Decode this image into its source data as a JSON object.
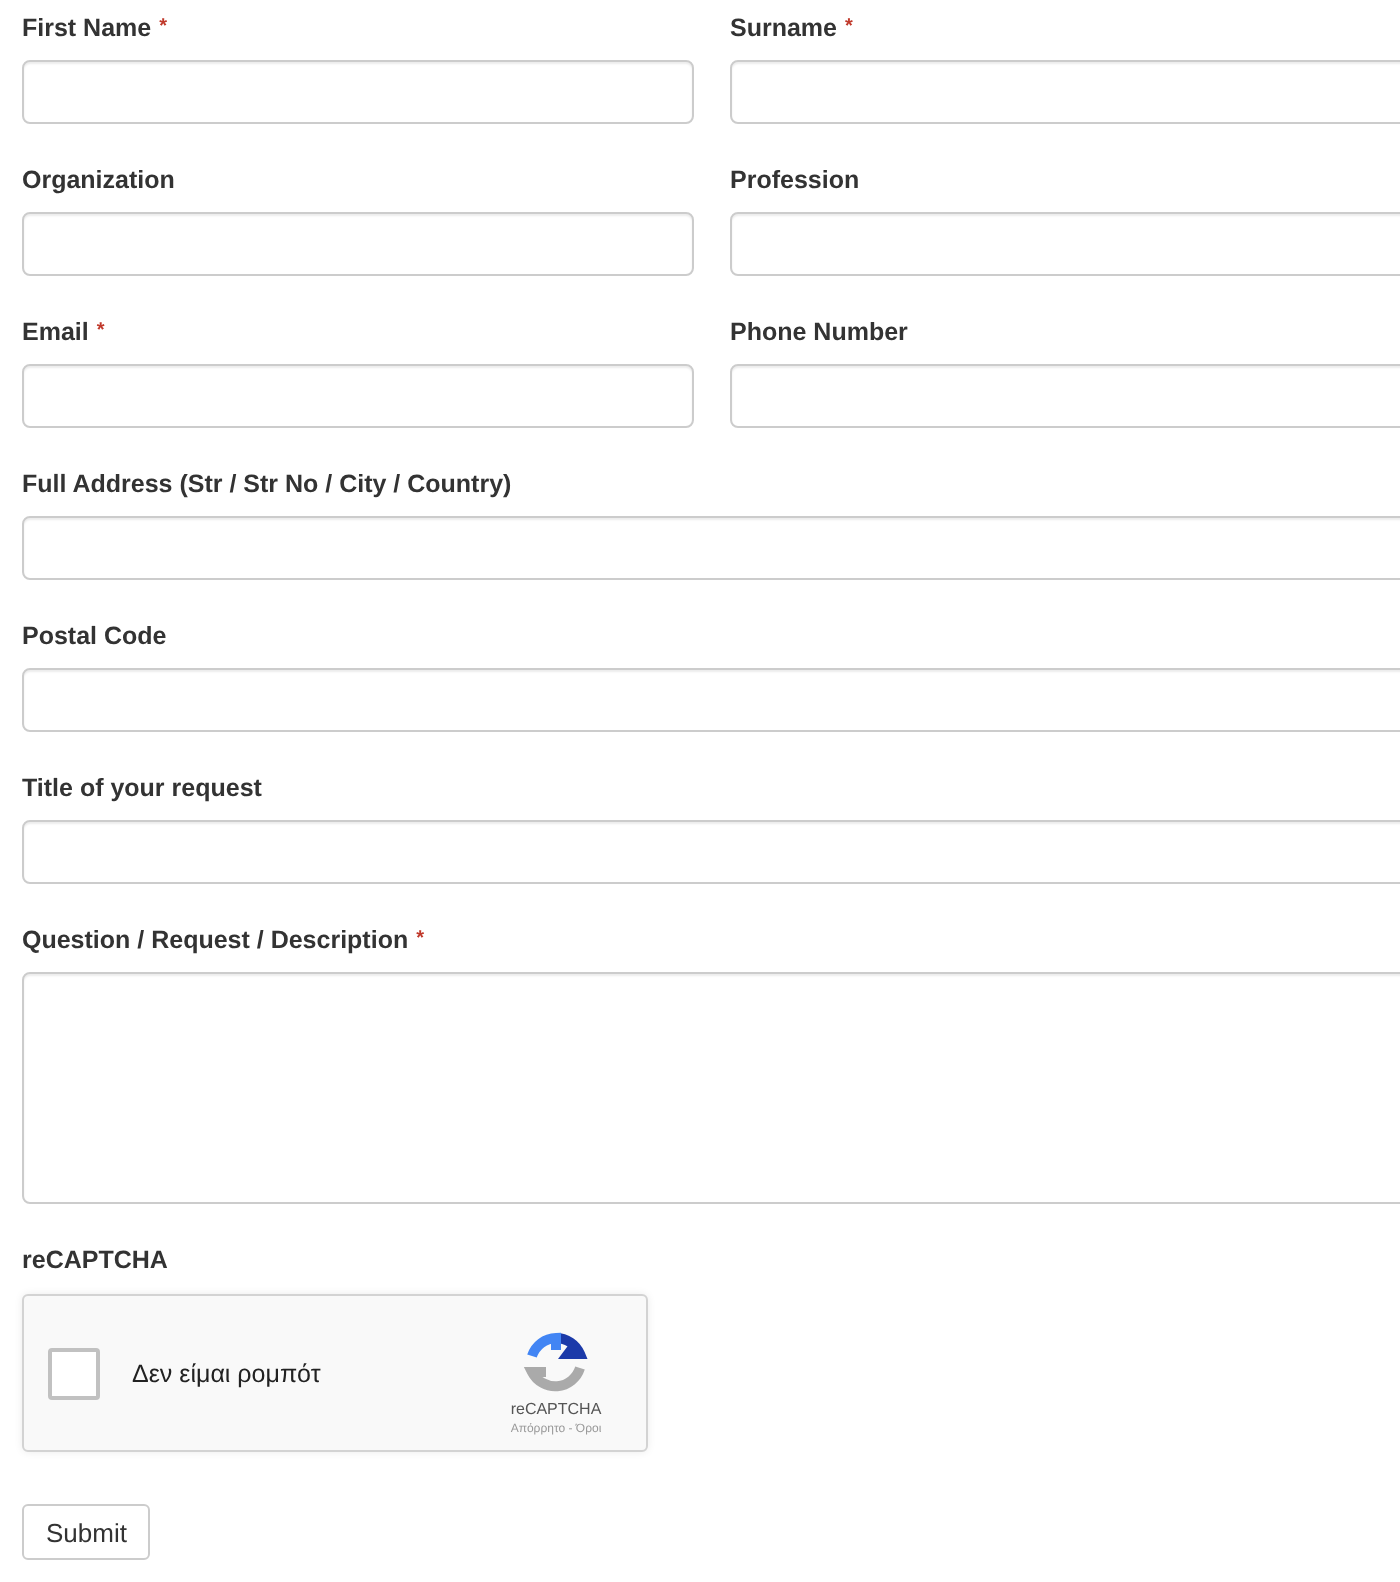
{
  "fields": [
    {
      "label": "First Name",
      "required_mark": "*",
      "kind": "half"
    },
    {
      "label": "Surname",
      "required_mark": "*",
      "kind": "half"
    },
    {
      "label": "Organization",
      "kind": "half"
    },
    {
      "label": "Profession",
      "kind": "half"
    },
    {
      "label": "Email",
      "required_mark": "*",
      "kind": "half"
    },
    {
      "label": "Phone Number",
      "kind": "half"
    },
    {
      "label": "Full Address (Str / Str No / City / Country)",
      "kind": "full"
    },
    {
      "label": "Postal Code",
      "kind": "full"
    },
    {
      "label": "Title of your request",
      "kind": "full"
    },
    {
      "label": "Question / Request / Description",
      "required_mark": "*",
      "kind": "textarea"
    }
  ],
  "captcha": {
    "label": "reCAPTCHA",
    "checkbox_label": "Δεν είμαι ρομπότ",
    "checked": false,
    "brand": "reCAPTCHA",
    "links": "Απόρρητο - Όροι"
  },
  "submit": {
    "label": "Submit"
  }
}
